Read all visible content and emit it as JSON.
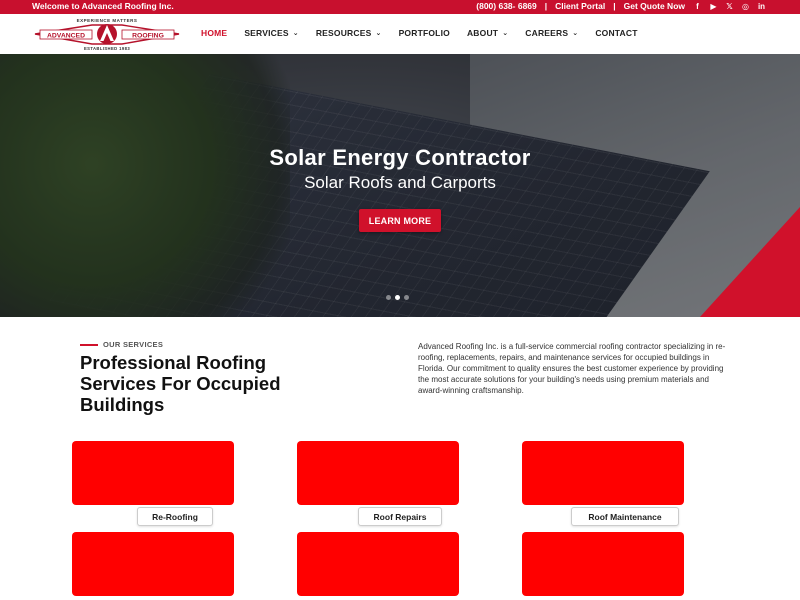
{
  "topbar": {
    "welcome": "Welcome to Advanced Roofing Inc.",
    "phone": "(800) 638- 6869",
    "client_portal": "Client Portal",
    "quote": "Get Quote Now",
    "social": [
      {
        "icon": "facebook-icon",
        "glyph": "f"
      },
      {
        "icon": "youtube-icon",
        "glyph": "▶"
      },
      {
        "icon": "x-icon",
        "glyph": "𝕏"
      },
      {
        "icon": "instagram-icon",
        "glyph": "◎"
      },
      {
        "icon": "linkedin-icon",
        "glyph": "in"
      }
    ],
    "color": "#c8102e"
  },
  "logo": {
    "top_text": "EXPERIENCE MATTERS",
    "left_text": "ADVANCED",
    "right_text": "ROOFING",
    "bottom_text": "ESTABLISHED 1983"
  },
  "nav": [
    {
      "label": "HOME",
      "active": true,
      "dropdown": false
    },
    {
      "label": "SERVICES",
      "active": false,
      "dropdown": true
    },
    {
      "label": "RESOURCES",
      "active": false,
      "dropdown": true
    },
    {
      "label": "PORTFOLIO",
      "active": false,
      "dropdown": false
    },
    {
      "label": "ABOUT",
      "active": false,
      "dropdown": true
    },
    {
      "label": "CAREERS",
      "active": false,
      "dropdown": true
    },
    {
      "label": "CONTACT",
      "active": false,
      "dropdown": false
    }
  ],
  "hero": {
    "title": "Solar Energy Contractor",
    "subtitle": "Solar Roofs and Carports",
    "button": "LEARN MORE",
    "slides": 3,
    "active_slide": 2
  },
  "services": {
    "eyebrow": "OUR SERVICES",
    "heading": "Professional Roofing Services For Occupied Buildings",
    "description": "Advanced Roofing Inc. is a full-service commercial roofing contractor specializing in re-roofing, replacements, repairs, and maintenance services for occupied buildings in Florida. Our commitment to quality ensures the best customer experience by providing the most accurate solutions for your building's needs using premium materials and award-winning craftsmanship.",
    "cards": [
      {
        "label": "Re-Roofing"
      },
      {
        "label": "Roof Repairs"
      },
      {
        "label": "Roof Maintenance"
      }
    ]
  },
  "accent_color": "#d0112b"
}
